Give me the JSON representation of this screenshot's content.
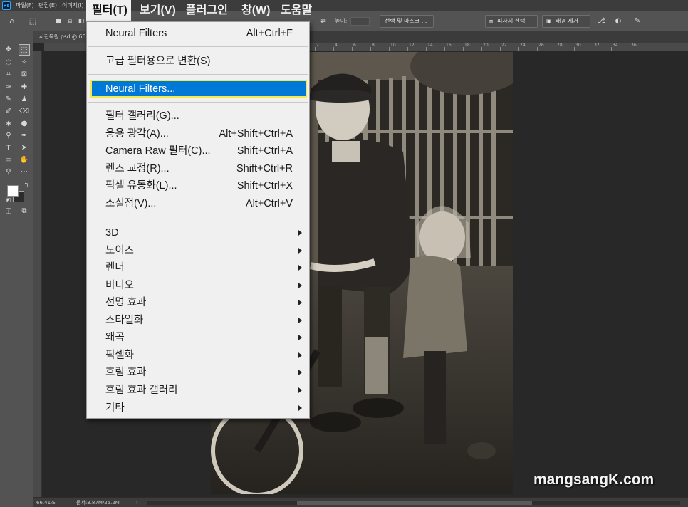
{
  "app": {
    "logo_text": "Ps"
  },
  "menubar": {
    "items": [
      "파일(F)",
      "편집(E)",
      "이미지(I)"
    ],
    "big_items": [
      "필터(T)",
      "보기(V)",
      "플러그인",
      "창(W)",
      "도움말"
    ]
  },
  "options": {
    "height_label": "높이:",
    "select_mask": "선택 및 마스크 ...",
    "select_subject": "피사체 선택",
    "remove_bg": "배경 제거"
  },
  "document": {
    "tab_title": "사진복원.psd @ 66",
    "ruler_marks": [
      "2",
      "4",
      "6",
      "8",
      "10",
      "12",
      "14",
      "16",
      "18",
      "20",
      "22",
      "24",
      "26",
      "28",
      "30",
      "32",
      "34",
      "36"
    ]
  },
  "status": {
    "zoom": "66.41%",
    "doc_size": "문서:3.87M/25.2M"
  },
  "filter_menu": {
    "last_filter": {
      "label": "Neural Filters",
      "shortcut": "Alt+Ctrl+F"
    },
    "convert_smart": {
      "label": "고급 필터용으로 변환(S)"
    },
    "neural_filters": {
      "label": "Neural Filters..."
    },
    "items": [
      {
        "label": "필터 갤러리(G)...",
        "shortcut": ""
      },
      {
        "label": "응용 광각(A)...",
        "shortcut": "Alt+Shift+Ctrl+A"
      },
      {
        "label": "Camera Raw 필터(C)...",
        "shortcut": "Shift+Ctrl+A"
      },
      {
        "label": "렌즈 교정(R)...",
        "shortcut": "Shift+Ctrl+R"
      },
      {
        "label": "픽셀 유동화(L)...",
        "shortcut": "Shift+Ctrl+X"
      },
      {
        "label": "소실점(V)...",
        "shortcut": "Alt+Ctrl+V"
      }
    ],
    "submenus": [
      "3D",
      "노이즈",
      "렌더",
      "비디오",
      "선명 효과",
      "스타일화",
      "왜곡",
      "픽셀화",
      "흐림 효과",
      "흐림 효과 갤러리",
      "기타"
    ]
  },
  "watermark": "mangsangK.com",
  "colors": {
    "highlight": "#0078d7",
    "highlight_border": "#f3ea4a",
    "menu_bg": "#f0f0f0"
  }
}
